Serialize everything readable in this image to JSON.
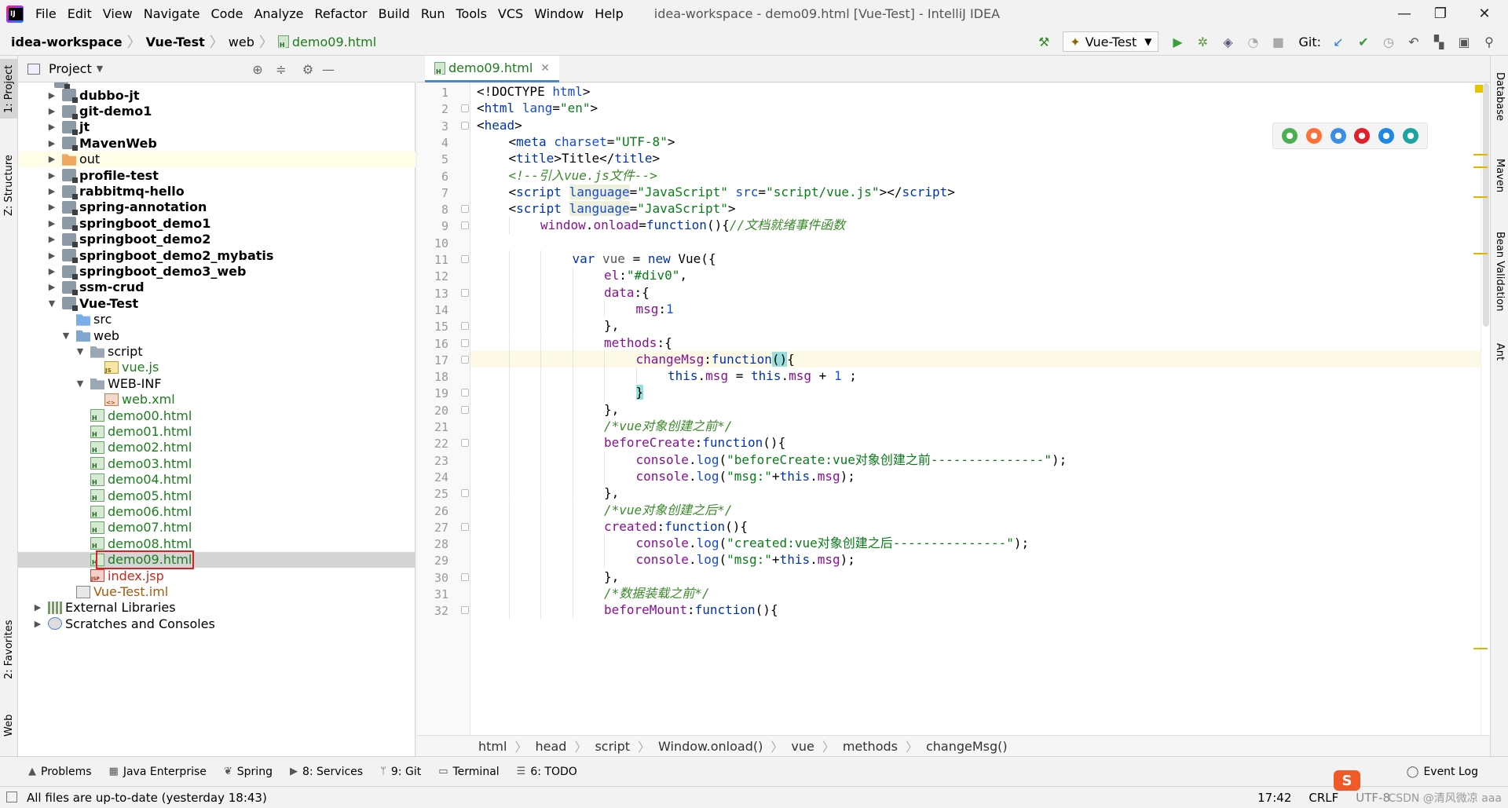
{
  "menubar": {
    "items": [
      "File",
      "Edit",
      "View",
      "Navigate",
      "Code",
      "Analyze",
      "Refactor",
      "Build",
      "Run",
      "Tools",
      "VCS",
      "Window",
      "Help"
    ],
    "title": "idea-workspace - demo09.html [Vue-Test] - IntelliJ IDEA"
  },
  "navbar": {
    "crumbs": [
      "idea-workspace",
      "Vue-Test",
      "web",
      "demo09.html"
    ],
    "run_config": "Vue-Test",
    "git_label": "Git:"
  },
  "left_strip": {
    "project_tab": "1: Project",
    "structure_tab": "Z: Structure",
    "favorites_tab": "2: Favorites",
    "web_tab": "Web"
  },
  "project": {
    "title": "Project",
    "tree": [
      {
        "label": "dubbo-jt",
        "icon": "module",
        "depth": 1,
        "arrow": "right",
        "style": "bold"
      },
      {
        "label": "git-demo1",
        "icon": "module",
        "depth": 1,
        "arrow": "right",
        "style": "bold"
      },
      {
        "label": "jt",
        "icon": "module",
        "depth": 1,
        "arrow": "right",
        "style": "bold"
      },
      {
        "label": "MavenWeb",
        "icon": "module",
        "depth": 1,
        "arrow": "right",
        "style": "bold"
      },
      {
        "label": "out",
        "icon": "folder-orange",
        "depth": 1,
        "arrow": "right",
        "style": "normal"
      },
      {
        "label": "profile-test",
        "icon": "module",
        "depth": 1,
        "arrow": "right",
        "style": "bold"
      },
      {
        "label": "rabbitmq-hello",
        "icon": "module",
        "depth": 1,
        "arrow": "right",
        "style": "bold"
      },
      {
        "label": "spring-annotation",
        "icon": "module",
        "depth": 1,
        "arrow": "right",
        "style": "bold"
      },
      {
        "label": "springboot_demo1",
        "icon": "module",
        "depth": 1,
        "arrow": "right",
        "style": "bold"
      },
      {
        "label": "springboot_demo2",
        "icon": "module",
        "depth": 1,
        "arrow": "right",
        "style": "bold"
      },
      {
        "label": "springboot_demo2_mybatis",
        "icon": "module",
        "depth": 1,
        "arrow": "right",
        "style": "bold"
      },
      {
        "label": "springboot_demo3_web",
        "icon": "module",
        "depth": 1,
        "arrow": "right",
        "style": "bold"
      },
      {
        "label": "ssm-crud",
        "icon": "module",
        "depth": 1,
        "arrow": "right",
        "style": "bold"
      },
      {
        "label": "Vue-Test",
        "icon": "module",
        "depth": 1,
        "arrow": "down",
        "style": "bold"
      },
      {
        "label": "src",
        "icon": "folder-src",
        "depth": 2,
        "arrow": "",
        "style": "normal"
      },
      {
        "label": "web",
        "icon": "folder-web",
        "depth": 2,
        "arrow": "down",
        "style": "normal"
      },
      {
        "label": "script",
        "icon": "folder",
        "depth": 3,
        "arrow": "down",
        "style": "normal"
      },
      {
        "label": "vue.js",
        "icon": "js",
        "depth": 4,
        "arrow": "",
        "style": "green"
      },
      {
        "label": "WEB-INF",
        "icon": "folder",
        "depth": 3,
        "arrow": "down",
        "style": "normal"
      },
      {
        "label": "web.xml",
        "icon": "xml",
        "depth": 4,
        "arrow": "",
        "style": "green"
      },
      {
        "label": "demo00.html",
        "icon": "html",
        "depth": 3,
        "arrow": "",
        "style": "green"
      },
      {
        "label": "demo01.html",
        "icon": "html",
        "depth": 3,
        "arrow": "",
        "style": "green"
      },
      {
        "label": "demo02.html",
        "icon": "html",
        "depth": 3,
        "arrow": "",
        "style": "green"
      },
      {
        "label": "demo03.html",
        "icon": "html",
        "depth": 3,
        "arrow": "",
        "style": "green"
      },
      {
        "label": "demo04.html",
        "icon": "html",
        "depth": 3,
        "arrow": "",
        "style": "green"
      },
      {
        "label": "demo05.html",
        "icon": "html",
        "depth": 3,
        "arrow": "",
        "style": "green"
      },
      {
        "label": "demo06.html",
        "icon": "html",
        "depth": 3,
        "arrow": "",
        "style": "green"
      },
      {
        "label": "demo07.html",
        "icon": "html",
        "depth": 3,
        "arrow": "",
        "style": "green"
      },
      {
        "label": "demo08.html",
        "icon": "html",
        "depth": 3,
        "arrow": "",
        "style": "green"
      },
      {
        "label": "demo09.html",
        "icon": "html",
        "depth": 3,
        "arrow": "",
        "style": "green",
        "selected": true
      },
      {
        "label": "index.jsp",
        "icon": "jsp",
        "depth": 3,
        "arrow": "",
        "style": "red"
      },
      {
        "label": "Vue-Test.iml",
        "icon": "iml",
        "depth": 2,
        "arrow": "",
        "style": "brown"
      },
      {
        "label": "External Libraries",
        "icon": "lib",
        "depth": 0,
        "arrow": "right",
        "style": "normal"
      },
      {
        "label": "Scratches and Consoles",
        "icon": "scratch",
        "depth": 0,
        "arrow": "right",
        "style": "normal"
      }
    ]
  },
  "editor": {
    "tab_label": "demo09.html",
    "caret_line": 17,
    "lines": [
      {
        "n": "1",
        "ind": 0,
        "fold": false,
        "html": "<span class=\"ident\">&lt;!DOCTYPE </span><span class=\"a\">html</span><span class=\"ident\">&gt;</span>"
      },
      {
        "n": "2",
        "ind": 0,
        "fold": true,
        "html": "<span class=\"ident\">&lt;</span><span class=\"t\">html </span><span class=\"a\">lang</span><span class=\"ident\">=</span><span class=\"s\">\"en\"</span><span class=\"ident\">&gt;</span>"
      },
      {
        "n": "3",
        "ind": 0,
        "fold": true,
        "html": "<span class=\"ident\">&lt;</span><span class=\"t\">head</span><span class=\"ident\">&gt;</span>"
      },
      {
        "n": "4",
        "ind": 1,
        "fold": false,
        "html": "<span class=\"ident\">&lt;</span><span class=\"t\">meta </span><span class=\"a\">charset</span><span class=\"ident\">=</span><span class=\"s\">\"UTF-8\"</span><span class=\"ident\">&gt;</span>"
      },
      {
        "n": "5",
        "ind": 1,
        "fold": false,
        "html": "<span class=\"ident\">&lt;</span><span class=\"t\">title</span><span class=\"ident\">&gt;Title&lt;/</span><span class=\"t\">title</span><span class=\"ident\">&gt;</span>"
      },
      {
        "n": "6",
        "ind": 1,
        "fold": false,
        "html": "<span class=\"cc\">&lt;!--引入vue.js文件--&gt;</span>"
      },
      {
        "n": "7",
        "ind": 1,
        "fold": false,
        "html": "<span class=\"ident\">&lt;</span><span class=\"t\">script </span><span class=\"a hlbg\">language</span><span class=\"ident\">=</span><span class=\"s\">\"JavaScript\" </span><span class=\"a\">src</span><span class=\"ident\">=</span><span class=\"s\">\"script/vue.js\"</span><span class=\"ident\">&gt;&lt;/</span><span class=\"t\">script</span><span class=\"ident\">&gt;</span>"
      },
      {
        "n": "8",
        "ind": 1,
        "fold": true,
        "html": "<span class=\"ident\">&lt;</span><span class=\"t\">script </span><span class=\"a hlbg\">language</span><span class=\"ident\">=</span><span class=\"s\">\"JavaScript\"</span><span class=\"ident\">&gt;</span>"
      },
      {
        "n": "9",
        "ind": 2,
        "fold": true,
        "html": "<span class=\"p\">window</span><span class=\"ident\">.</span><span class=\"p\">onload</span><span class=\"ident\">=</span><span class=\"k\">function</span><span class=\"ident\">(){</span><span class=\"cc\">//文档就绪事件函数</span>"
      },
      {
        "n": "10",
        "ind": 0,
        "fold": false,
        "html": ""
      },
      {
        "n": "11",
        "ind": 3,
        "fold": true,
        "html": "<span class=\"k\">var </span><span class=\"ident\" style=\"color:#555\">vue </span><span class=\"ident\">= </span><span class=\"k\">new </span><span class=\"ident\">Vue({</span>"
      },
      {
        "n": "12",
        "ind": 4,
        "fold": false,
        "html": "<span class=\"p\">el</span><span class=\"ident\">:</span><span class=\"s\">\"#div0\"</span><span class=\"ident\">,</span>"
      },
      {
        "n": "13",
        "ind": 4,
        "fold": true,
        "html": "<span class=\"p\">data</span><span class=\"ident\">:{</span>"
      },
      {
        "n": "14",
        "ind": 5,
        "fold": false,
        "html": "<span class=\"p\">msg</span><span class=\"ident\">:</span><span class=\"n\">1</span>"
      },
      {
        "n": "15",
        "ind": 4,
        "fold": true,
        "html": "<span class=\"ident\">},</span>"
      },
      {
        "n": "16",
        "ind": 4,
        "fold": true,
        "html": "<span class=\"p\">methods</span><span class=\"ident\">:{</span>"
      },
      {
        "n": "17",
        "ind": 5,
        "fold": true,
        "html": "<span class=\"p\">changeMsg</span><span class=\"ident\">:</span><span class=\"k\">function</span><span class=\"brace-hl\">()</span><span class=\"ident\">{</span>"
      },
      {
        "n": "18",
        "ind": 6,
        "fold": false,
        "html": "<span class=\"k\">this</span><span class=\"ident\">.</span><span class=\"p\">msg </span><span class=\"ident\">= </span><span class=\"k\">this</span><span class=\"ident\">.</span><span class=\"p\">msg </span><span class=\"ident\">+ </span><span class=\"n\">1 </span><span class=\"ident\">;</span>"
      },
      {
        "n": "19",
        "ind": 5,
        "fold": true,
        "html": "<span class=\"brace-hl\">}</span>"
      },
      {
        "n": "20",
        "ind": 4,
        "fold": true,
        "html": "<span class=\"ident\">},</span>"
      },
      {
        "n": "21",
        "ind": 4,
        "fold": false,
        "html": "<span class=\"cc\">/*vue对象创建之前*/</span>"
      },
      {
        "n": "22",
        "ind": 4,
        "fold": true,
        "html": "<span class=\"p\">beforeCreate</span><span class=\"ident\">:</span><span class=\"k\">function</span><span class=\"ident\">(){</span>"
      },
      {
        "n": "23",
        "ind": 5,
        "fold": false,
        "html": "<span class=\"p\">console</span><span class=\"ident\">.</span><span class=\"a\">log</span><span class=\"ident\">(</span><span class=\"s\">\"beforeCreate:vue对象创建之前---------------\"</span><span class=\"ident\">);</span>"
      },
      {
        "n": "24",
        "ind": 5,
        "fold": false,
        "html": "<span class=\"p\">console</span><span class=\"ident\">.</span><span class=\"a\">log</span><span class=\"ident\">(</span><span class=\"s\">\"msg:\"</span><span class=\"ident\">+</span><span class=\"k\">this</span><span class=\"ident\">.</span><span class=\"p\">msg</span><span class=\"ident\">);</span>"
      },
      {
        "n": "25",
        "ind": 4,
        "fold": true,
        "html": "<span class=\"ident\">},</span>"
      },
      {
        "n": "26",
        "ind": 4,
        "fold": false,
        "html": "<span class=\"cc\">/*vue对象创建之后*/</span>"
      },
      {
        "n": "27",
        "ind": 4,
        "fold": true,
        "html": "<span class=\"p\">created</span><span class=\"ident\">:</span><span class=\"k\">function</span><span class=\"ident\">(){</span>"
      },
      {
        "n": "28",
        "ind": 5,
        "fold": false,
        "html": "<span class=\"p\">console</span><span class=\"ident\">.</span><span class=\"a\">log</span><span class=\"ident\">(</span><span class=\"s\">\"created:vue对象创建之后---------------\"</span><span class=\"ident\">);</span>"
      },
      {
        "n": "29",
        "ind": 5,
        "fold": false,
        "html": "<span class=\"p\">console</span><span class=\"ident\">.</span><span class=\"a\">log</span><span class=\"ident\">(</span><span class=\"s\">\"msg:\"</span><span class=\"ident\">+</span><span class=\"k\">this</span><span class=\"ident\">.</span><span class=\"p\">msg</span><span class=\"ident\">);</span>"
      },
      {
        "n": "30",
        "ind": 4,
        "fold": true,
        "html": "<span class=\"ident\">},</span>"
      },
      {
        "n": "31",
        "ind": 4,
        "fold": false,
        "html": "<span class=\"cc\">/*数据装载之前*/</span>"
      },
      {
        "n": "32",
        "ind": 4,
        "fold": true,
        "html": "<span class=\"p\">beforeMount</span><span class=\"ident\">:</span><span class=\"k\">function</span><span class=\"ident\">(){</span>"
      }
    ],
    "crumbs": [
      "html",
      "head",
      "script",
      "Window.onload()",
      "vue",
      "methods",
      "changeMsg()"
    ]
  },
  "browser_icons": [
    {
      "name": "chrome-icon",
      "color": "#4caf50"
    },
    {
      "name": "firefox-icon",
      "color": "#ff7139"
    },
    {
      "name": "safari-icon",
      "color": "#3a8ee6"
    },
    {
      "name": "opera-icon",
      "color": "#e0202a"
    },
    {
      "name": "ie-icon",
      "color": "#1e88e5"
    },
    {
      "name": "edge-icon",
      "color": "#1aa5a0"
    }
  ],
  "right_strip": {
    "database_tab": "Database",
    "maven_tab": "Maven",
    "bean_tab": "Bean Validation",
    "ant_tab": "Ant"
  },
  "bottom_bar": {
    "tabs": [
      {
        "icon": "problems-icon",
        "glyph": "▲",
        "label": "Problems"
      },
      {
        "icon": "java-enterprise-icon",
        "glyph": "▦",
        "label": "Java Enterprise"
      },
      {
        "icon": "spring-icon",
        "glyph": "❦",
        "label": "Spring"
      },
      {
        "icon": "services-icon",
        "glyph": "▶",
        "label": "8: Services"
      },
      {
        "icon": "git-icon",
        "glyph": "ᛘ",
        "label": "9: Git"
      },
      {
        "icon": "terminal-icon",
        "glyph": "▭",
        "label": "Terminal"
      },
      {
        "icon": "todo-icon",
        "glyph": "☰",
        "label": "6: TODO"
      }
    ],
    "event_log": "Event Log"
  },
  "status": {
    "message": "All files are up-to-date (yesterday 18:43)",
    "position": "17:42",
    "line_sep": "CRLF",
    "encoding": "UTF-8",
    "watermark": "CSDN @清风微凉 aaa"
  },
  "colors": {
    "accent": "#4a88c7",
    "selection_box": "#e02020",
    "file_green": "#1a7e1a"
  }
}
